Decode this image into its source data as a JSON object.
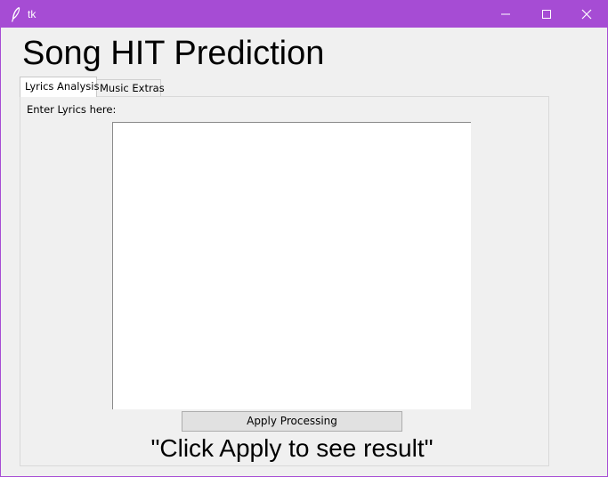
{
  "window": {
    "title": "tk",
    "accent_color": "#a64cd4",
    "icons": {
      "app": "feather-icon",
      "minimize": "minimize-icon",
      "maximize": "maximize-icon",
      "close": "close-icon"
    }
  },
  "app": {
    "heading": "Song HIT Prediction"
  },
  "tabs": [
    {
      "label": "Lyrics Analysis",
      "selected": true
    },
    {
      "label": "Music Extras",
      "selected": false
    }
  ],
  "lyrics_tab": {
    "label": "Enter Lyrics here:",
    "lyrics_value": "",
    "apply_button_label": "Apply Processing",
    "result_text": "\"Click Apply to see result\""
  }
}
